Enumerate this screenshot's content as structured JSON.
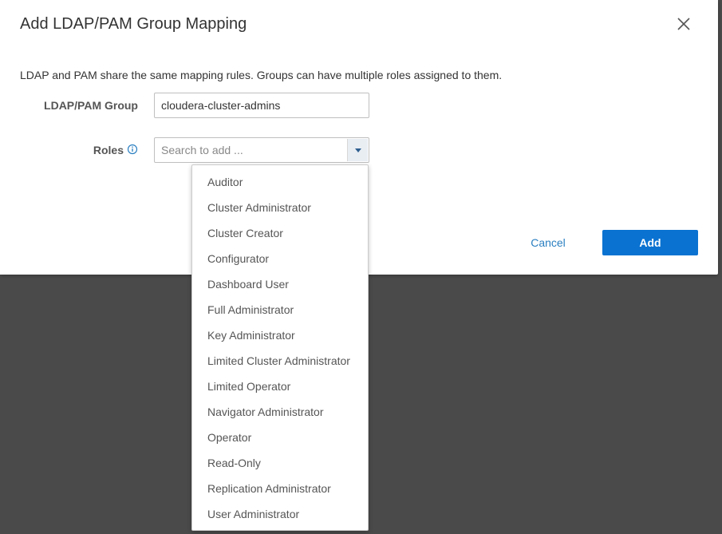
{
  "dialog": {
    "title": "Add LDAP/PAM Group Mapping",
    "close_icon": "close-icon",
    "description": "LDAP and PAM share the same mapping rules. Groups can have multiple roles assigned to them."
  },
  "form": {
    "group_label": "LDAP/PAM Group",
    "group_value": "cloudera-cluster-admins",
    "roles_label": "Roles",
    "roles_info_icon": "info-icon",
    "roles_placeholder": "Search to add ...",
    "dropdown_icon": "caret-down-icon"
  },
  "roles_options": [
    "Auditor",
    "Cluster Administrator",
    "Cluster Creator",
    "Configurator",
    "Dashboard User",
    "Full Administrator",
    "Key Administrator",
    "Limited Cluster Administrator",
    "Limited Operator",
    "Navigator Administrator",
    "Operator",
    "Read-Only",
    "Replication Administrator",
    "User Administrator"
  ],
  "footer": {
    "cancel_label": "Cancel",
    "add_label": "Add"
  },
  "colors": {
    "primary": "#0a72d1",
    "link": "#2a7fc1",
    "overlay": "#4a4a4a"
  }
}
